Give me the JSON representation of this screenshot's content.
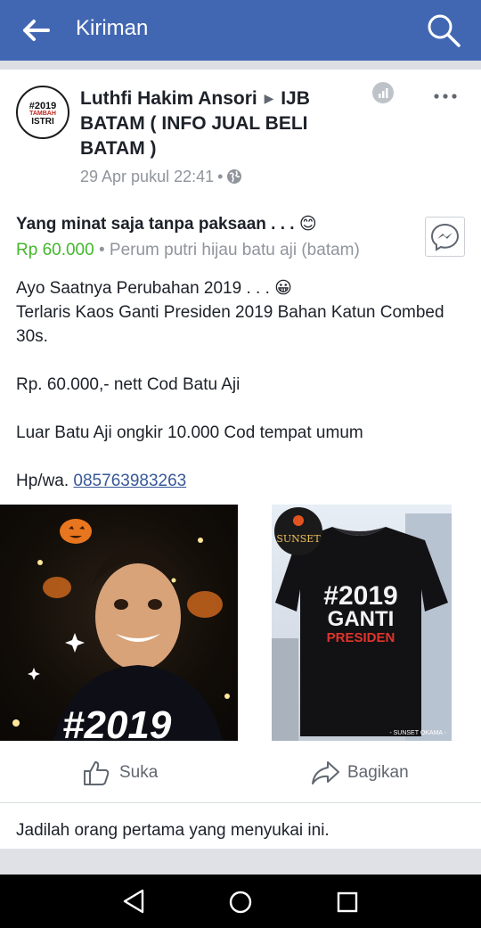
{
  "topbar": {
    "title": "Kiriman",
    "back_icon": "arrow-left-icon",
    "search_icon": "search-icon",
    "color": "#4267b2"
  },
  "post": {
    "avatar_text": {
      "line1": "#2019",
      "line2": "TAMBAH",
      "line3": "ISTRI"
    },
    "author": "Luthfi Hakim Ansori",
    "group": "IJB BATAM ( INFO JUAL BELI BATAM )",
    "timestamp": "29 Apr pukul 22:41",
    "privacy_icon": "globe-icon",
    "sale_title": "Yang minat saja tanpa paksaan . . . 😊",
    "price": "Rp 60.000",
    "location": "Perum putri hijau batu aji (batam)",
    "message_icon": "messenger-icon",
    "body": [
      "Ayo Saatnya Perubahan 2019 . . . 😀",
      "Terlaris Kaos Ganti Presiden 2019 Bahan Katun Combed 30s.",
      "",
      "Rp. 60.000,- nett Cod Batu Aji",
      "",
      "Luar Batu Aji ongkir 10.000 Cod tempat umum",
      ""
    ],
    "contact_label": "Hp/wa.",
    "contact_number": "085763983263",
    "photo_left_text": "#2019",
    "photo_right": {
      "brand": "SUNSET",
      "shirt_line1": "#2019",
      "shirt_line2": "GANTI",
      "shirt_line3": "PRESIDEN",
      "watermark": "- SUNSET OKAMA -"
    }
  },
  "actions": {
    "like_label": "Suka",
    "share_label": "Bagikan",
    "price_color": "#42b72a"
  },
  "footer": {
    "likes_text": "Jadilah orang pertama yang menyukai ini."
  },
  "android_nav": {
    "back": "nav-back-triangle-icon",
    "home": "nav-home-circle-icon",
    "recent": "nav-recent-square-icon"
  }
}
